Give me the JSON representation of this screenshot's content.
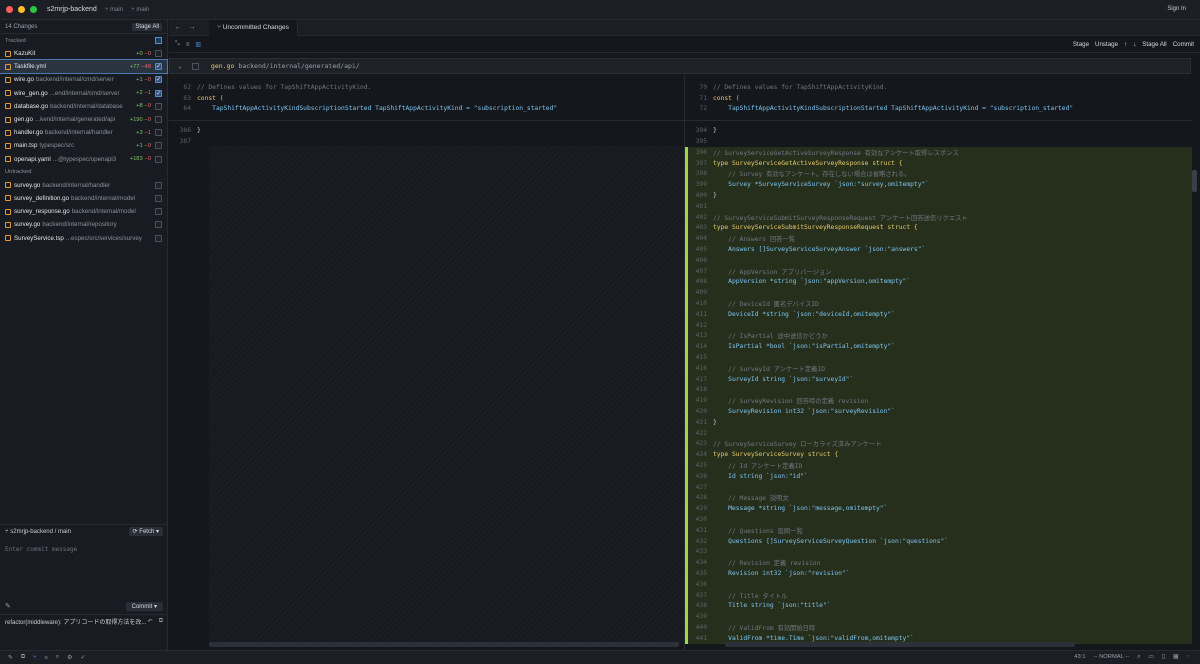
{
  "window": {
    "repo": "s2mrjp-backend",
    "branch_a": "main",
    "branch_b": "main",
    "signin": "Sign In"
  },
  "sidebar": {
    "changes_count": "14 Changes",
    "stage_all": "Stage All",
    "tracked_label": "Tracked",
    "untracked_label": "Untracked",
    "tracked": [
      {
        "name": "KazuKit",
        "path": "",
        "add": "+0",
        "del": "−0",
        "checked": false
      },
      {
        "name": "Taskfile.yml",
        "path": "",
        "add": "+77",
        "del": "−48",
        "checked": true
      },
      {
        "name": "wire.go",
        "path": "backend/internal/cmd/server",
        "add": "+1",
        "del": "−0",
        "checked": true
      },
      {
        "name": "wire_gen.go",
        "path": "...end/internal/cmd/server",
        "add": "+2",
        "del": "−1",
        "checked": true
      },
      {
        "name": "database.go",
        "path": "backend/internal/database",
        "add": "+8",
        "del": "−0",
        "checked": false
      },
      {
        "name": "gen.go",
        "path": "...kend/internal/generated/api",
        "add": "+190",
        "del": "−0",
        "checked": false
      },
      {
        "name": "handler.go",
        "path": "backend/internal/handler",
        "add": "+3",
        "del": "−1",
        "checked": false
      },
      {
        "name": "main.tsp",
        "path": "typespec/src",
        "add": "+1",
        "del": "−0",
        "checked": false
      },
      {
        "name": "openapi.yaml",
        "path": "...@typespec/openapi3",
        "add": "+183",
        "del": "−0",
        "checked": false
      }
    ],
    "untracked": [
      {
        "name": "survey.go",
        "path": "backend/internal/handler"
      },
      {
        "name": "survey_definition.go",
        "path": "backend/internal/model"
      },
      {
        "name": "survey_response.go",
        "path": "backend/internal/model"
      },
      {
        "name": "survey.go",
        "path": "backend/internal/repository"
      },
      {
        "name": "SurveyService.tsp",
        "path": "...espec/src/services/survey"
      }
    ],
    "branch_label": "s2mrjp-backend / main",
    "fetch": "Fetch",
    "commit_placeholder": "Enter commit message",
    "commit": "Commit",
    "last_commit": "refactor(middleware): アプリコードの取得方法を改..."
  },
  "main": {
    "tab": "Uncommitted Changes",
    "actions": {
      "stage": "Stage",
      "unstage": "Unstage",
      "stage_all": "Stage All",
      "commit": "Commit"
    },
    "file": {
      "name": "gen.go",
      "path": "backend/internal/generated/api/"
    }
  },
  "left_lines": [
    {
      "n": "62",
      "t": "// Defines values for TapShiftAppActivityKind.",
      "k": "com"
    },
    {
      "n": "63",
      "t": "const (",
      "k": "kw"
    },
    {
      "n": "64",
      "t": "    TapShiftAppActivityKindSubscriptionStarted TapShiftAppActivityKind = \"subscription_started\"",
      "k": "id"
    }
  ],
  "left_lines2": [
    {
      "n": "386",
      "t": "}",
      "k": "plain"
    },
    {
      "n": "387",
      "t": "",
      "k": "plain"
    }
  ],
  "right_lines": [
    {
      "n": "70",
      "t": "// Defines values for TapShiftAppActivityKind.",
      "k": "com"
    },
    {
      "n": "71",
      "t": "const (",
      "k": "kw"
    },
    {
      "n": "72",
      "t": "    TapShiftAppActivityKindSubscriptionStarted TapShiftAppActivityKind = \"subscription_started\"",
      "k": "id"
    }
  ],
  "right_lines2": [
    {
      "n": "394",
      "t": "}",
      "k": "plain"
    },
    {
      "n": "395",
      "t": "",
      "k": "plain"
    }
  ],
  "added_lines": [
    {
      "n": "396",
      "t": "// SurveyServiceGetActiveSurveyResponse 有効なアンケート取得レスポンス",
      "k": "com"
    },
    {
      "n": "397",
      "t": "type SurveyServiceGetActiveSurveyResponse struct {",
      "k": "kw"
    },
    {
      "n": "398",
      "t": "    // Survey 有効なアンケート。存在しない場合は省略される。",
      "k": "com"
    },
    {
      "n": "399",
      "t": "    Survey *SurveyServiceSurvey `json:\"survey,omitempty\"`",
      "k": "id"
    },
    {
      "n": "400",
      "t": "}",
      "k": "plain"
    },
    {
      "n": "401",
      "t": "",
      "k": "plain"
    },
    {
      "n": "402",
      "t": "// SurveyServiceSubmitSurveyResponseRequest アンケート回答送信リクエスト",
      "k": "com"
    },
    {
      "n": "403",
      "t": "type SurveyServiceSubmitSurveyResponseRequest struct {",
      "k": "kw"
    },
    {
      "n": "404",
      "t": "    // Answers 回答一覧",
      "k": "com"
    },
    {
      "n": "405",
      "t": "    Answers []SurveyServiceSurveyAnswer `json:\"answers\"`",
      "k": "id"
    },
    {
      "n": "406",
      "t": "",
      "k": "plain"
    },
    {
      "n": "407",
      "t": "    // AppVersion アプリバージョン",
      "k": "com"
    },
    {
      "n": "408",
      "t": "    AppVersion *string `json:\"appVersion,omitempty\"`",
      "k": "id"
    },
    {
      "n": "409",
      "t": "",
      "k": "plain"
    },
    {
      "n": "410",
      "t": "    // DeviceId 匿名デバイスID",
      "k": "com"
    },
    {
      "n": "411",
      "t": "    DeviceId *string `json:\"deviceId,omitempty\"`",
      "k": "id"
    },
    {
      "n": "412",
      "t": "",
      "k": "plain"
    },
    {
      "n": "413",
      "t": "    // IsPartial 途中送信かどうか",
      "k": "com"
    },
    {
      "n": "414",
      "t": "    IsPartial *bool `json:\"isPartial,omitempty\"`",
      "k": "id"
    },
    {
      "n": "415",
      "t": "",
      "k": "plain"
    },
    {
      "n": "416",
      "t": "    // SurveyId アンケート定義ID",
      "k": "com"
    },
    {
      "n": "417",
      "t": "    SurveyId string `json:\"surveyId\"`",
      "k": "id"
    },
    {
      "n": "418",
      "t": "",
      "k": "plain"
    },
    {
      "n": "419",
      "t": "    // SurveyRevision 回答時の定義 revision",
      "k": "com"
    },
    {
      "n": "420",
      "t": "    SurveyRevision int32 `json:\"surveyRevision\"`",
      "k": "id"
    },
    {
      "n": "421",
      "t": "}",
      "k": "plain"
    },
    {
      "n": "422",
      "t": "",
      "k": "plain"
    },
    {
      "n": "423",
      "t": "// SurveyServiceSurvey ローカライズ済みアンケート",
      "k": "com"
    },
    {
      "n": "424",
      "t": "type SurveyServiceSurvey struct {",
      "k": "kw"
    },
    {
      "n": "425",
      "t": "    // Id アンケート定義ID",
      "k": "com"
    },
    {
      "n": "426",
      "t": "    Id string `json:\"id\"`",
      "k": "id"
    },
    {
      "n": "427",
      "t": "",
      "k": "plain"
    },
    {
      "n": "428",
      "t": "    // Message 説明文",
      "k": "com"
    },
    {
      "n": "429",
      "t": "    Message *string `json:\"message,omitempty\"`",
      "k": "id"
    },
    {
      "n": "430",
      "t": "",
      "k": "plain"
    },
    {
      "n": "431",
      "t": "    // Questions 設問一覧",
      "k": "com"
    },
    {
      "n": "432",
      "t": "    Questions []SurveyServiceSurveyQuestion `json:\"questions\"`",
      "k": "id"
    },
    {
      "n": "433",
      "t": "",
      "k": "plain"
    },
    {
      "n": "434",
      "t": "    // Revision 定義 revision",
      "k": "com"
    },
    {
      "n": "435",
      "t": "    Revision int32 `json:\"revision\"`",
      "k": "id"
    },
    {
      "n": "436",
      "t": "",
      "k": "plain"
    },
    {
      "n": "437",
      "t": "    // Title タイトル",
      "k": "com"
    },
    {
      "n": "438",
      "t": "    Title string `json:\"title\"`",
      "k": "id"
    },
    {
      "n": "439",
      "t": "",
      "k": "plain"
    },
    {
      "n": "440",
      "t": "    // ValidFrom 有効開始日時",
      "k": "com"
    },
    {
      "n": "441",
      "t": "    ValidFrom *time.Time `json:\"validFrom,omitempty\"`",
      "k": "id"
    }
  ],
  "status": {
    "position": "43:1",
    "mode": "-- NORMAL --"
  },
  "colors": {
    "accent": "#4a90d9",
    "added_bg": "#262f1c",
    "added_bar": "#9fd54a"
  }
}
